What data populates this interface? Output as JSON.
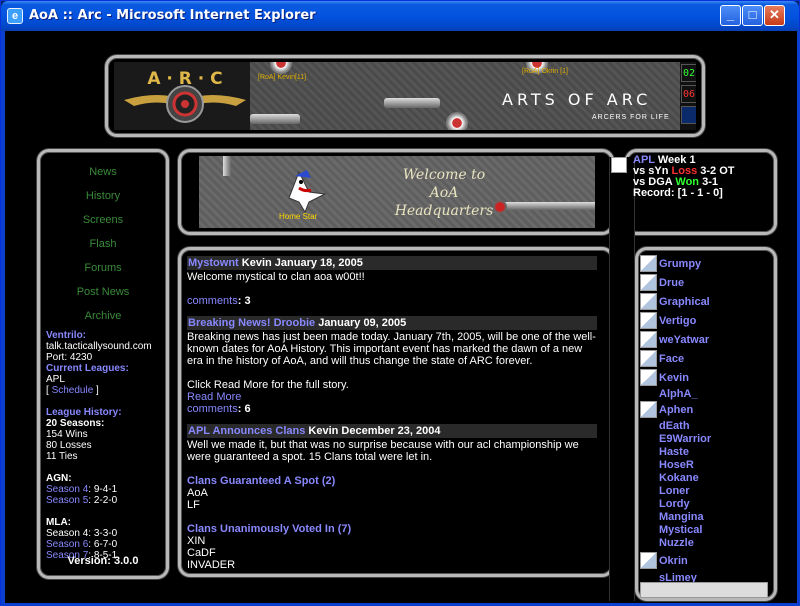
{
  "window": {
    "title": "AoA :: Arc - Microsoft Internet Explorer",
    "icon_glyph": "e"
  },
  "controls": {
    "minimize": "_",
    "maximize": "□",
    "close": "✕"
  },
  "banner": {
    "logo_text": "A · R · C",
    "title": "ARTS OF ARC",
    "tagline": "ARCERS FOR LIFE",
    "player_left": "[RoA] Kevin[11]",
    "player_right": "[RoA] Okrin [1]",
    "score_1": "02",
    "score_2": "06"
  },
  "nav": {
    "items": [
      "News",
      "History",
      "Screens",
      "Flash",
      "Forums",
      "Post News",
      "Archive"
    ]
  },
  "sidebar": {
    "ventrilo_label": "Ventrilo:",
    "ventrilo_host": "talk.tacticallysound.com",
    "ventrilo_port": "Port: 4230",
    "leagues_label": "Current Leagues:",
    "league_name": "APL",
    "schedule_open": "[",
    "schedule_link": "Schedule",
    "schedule_close": "]",
    "history_label": "League History:",
    "seasons": "20 Seasons:",
    "wins": "154 Wins",
    "losses": "80 Losses",
    "ties": "11 Ties",
    "agn_label": "AGN:",
    "agn_s4_label": "Season 4",
    "agn_s4_rec": ": 9-4-1",
    "agn_s5_label": "Season 5",
    "agn_s5_rec": ": 2-2-0",
    "mla_label": "MLA:",
    "mla_s4_label": "Season 4",
    "mla_s4_rec": ": 3-3-0",
    "mla_s6_label": "Season 6",
    "mla_s6_rec": ": 6-7-0",
    "mla_s7_label": "Season 7",
    "mla_s7_rec": ": 8-5-1",
    "version": "Version: 3.0.0"
  },
  "welcome": {
    "line1": "Welcome to",
    "line2": "AoA",
    "line3": "Headquarters",
    "character": "Home Star"
  },
  "news": [
    {
      "title": "Mystownt",
      "byline": " Kevin January 18, 2005",
      "body": "Welcome mystical to clan aoa w00t!!",
      "comments_label": "comments",
      "comments_count": ": 3"
    },
    {
      "title": "Breaking News! Droobie",
      "byline": " January 09, 2005",
      "body": "Breaking news has just been made today. January 7th, 2005, will be one of the well-known dates for AoA History. This important event has marked the dawn of a new era in the history of AoA, and will thus change the state of ARC forever.",
      "body2": "Click Read More for the full story.",
      "read_more": "Read More",
      "comments_label": "comments",
      "comments_count": ": 6"
    },
    {
      "title": "APL Announces Clans",
      "byline": " Kevin December 23, 2004",
      "body": "Well we made it, but that was no surprise because with our acl championship we were guaranteed a spot. 15 Clans total were let in.",
      "sub1": "Clans Guaranteed A Spot (2)",
      "sub1_items": [
        "AoA",
        "LF"
      ],
      "sub2": "Clans Unanimously Voted In (7)",
      "sub2_items": [
        "XIN",
        "CaDF",
        "INVADER"
      ]
    }
  ],
  "match": {
    "league": "APL",
    "week": " Week 1",
    "vs1": "vs sYn ",
    "vs1_result": "Loss",
    "vs1_score": " 3-2 OT",
    "vs2": "vs DGA ",
    "vs2_result": "Won",
    "vs2_score": " 3-1",
    "record": "Record: [1 - 1 - 0]"
  },
  "roster": {
    "with_avatar": [
      "Grumpy",
      "Drue",
      "Graphical",
      "Vertigo",
      "weYatwar",
      "Face",
      "Kevin"
    ],
    "alpha": "AlphA_",
    "aphen": "Aphen",
    "no_avatar": [
      "dEath",
      "E9Warrior",
      "Haste",
      "HoseR",
      "Kokane",
      "Loner",
      "Lordy",
      "Mangina",
      "Mystical",
      "Nuzzle"
    ],
    "okrin": "Okrin",
    "slimey": "sLimey"
  },
  "colors": {
    "link": "#8888ff",
    "nav": "#3a8a3a",
    "loss": "#ff3030",
    "won": "#30ff30"
  }
}
